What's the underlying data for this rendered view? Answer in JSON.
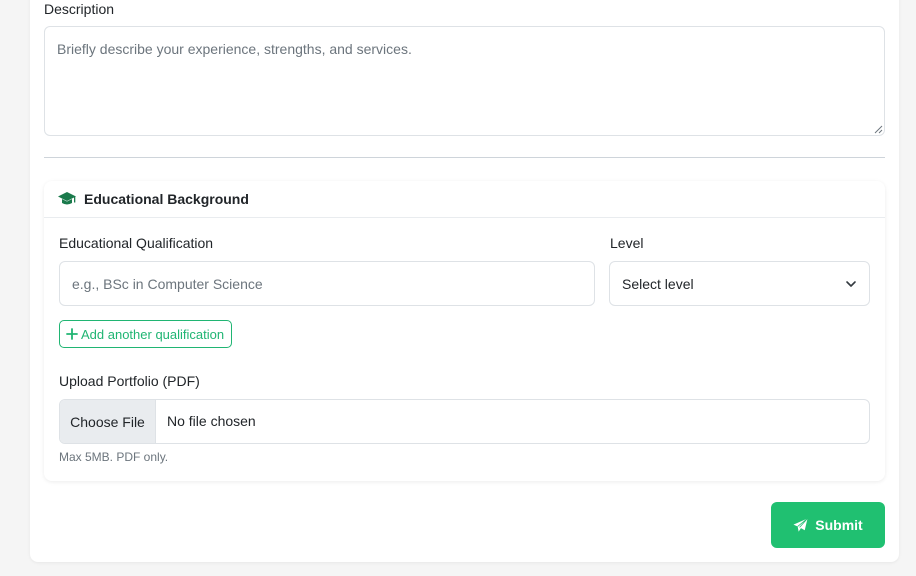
{
  "description": {
    "label": "Description",
    "placeholder": "Briefly describe your experience, strengths, and services.",
    "value": ""
  },
  "education": {
    "title": "Educational Background",
    "icon": "graduation-cap-icon",
    "qualification": {
      "label": "Educational Qualification",
      "placeholder": "e.g., BSc in Computer Science"
    },
    "level": {
      "label": "Level",
      "selected": "Select level"
    },
    "add_button_label": "Add another qualification",
    "portfolio": {
      "label": "Upload Portfolio (PDF)",
      "choose_label": "Choose File",
      "status": "No file chosen",
      "hint": "Max 5MB. PDF only."
    }
  },
  "submit_label": "Submit",
  "colors": {
    "accent": "#20c071",
    "icon_green": "#1a7a4c",
    "border": "#dee2e6",
    "muted": "#6c757d"
  }
}
